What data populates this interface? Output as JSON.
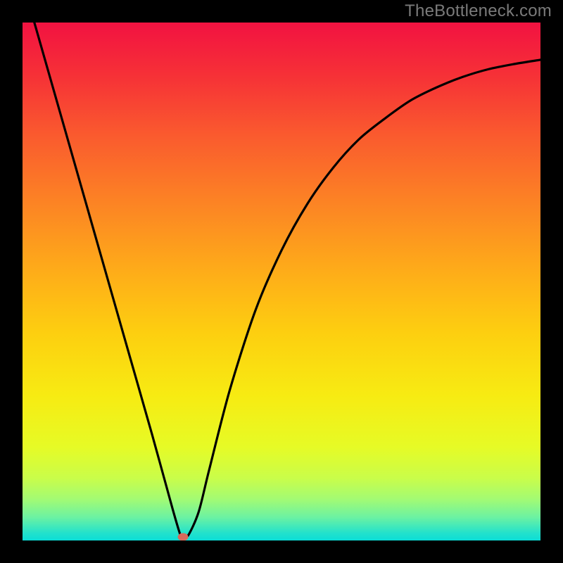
{
  "watermark_text": "TheBottleneck.com",
  "chart_data": {
    "type": "line",
    "title": "",
    "xlabel": "",
    "ylabel": "",
    "xlim": [
      0,
      1
    ],
    "ylim": [
      0,
      1
    ],
    "grid": false,
    "series": [
      {
        "name": "bottleneck-curve",
        "x": [
          0.0,
          0.05,
          0.1,
          0.15,
          0.2,
          0.25,
          0.29,
          0.305,
          0.31,
          0.32,
          0.34,
          0.36,
          0.4,
          0.45,
          0.5,
          0.55,
          0.6,
          0.65,
          0.7,
          0.75,
          0.8,
          0.85,
          0.9,
          0.95,
          1.0
        ],
        "values": [
          1.08,
          0.905,
          0.73,
          0.555,
          0.38,
          0.205,
          0.06,
          0.01,
          0.007,
          0.01,
          0.055,
          0.135,
          0.29,
          0.445,
          0.56,
          0.65,
          0.72,
          0.775,
          0.815,
          0.85,
          0.875,
          0.895,
          0.91,
          0.92,
          0.928
        ]
      }
    ],
    "minimum_point": {
      "x": 0.31,
      "y": 0.007
    },
    "marker_color": "#d86a5c",
    "gradient": {
      "stops": [
        {
          "offset": 0.0,
          "color": "#f21241"
        },
        {
          "offset": 0.1,
          "color": "#f63037"
        },
        {
          "offset": 0.22,
          "color": "#fa5b2e"
        },
        {
          "offset": 0.35,
          "color": "#fc8424"
        },
        {
          "offset": 0.48,
          "color": "#feac19"
        },
        {
          "offset": 0.6,
          "color": "#fdcf10"
        },
        {
          "offset": 0.72,
          "color": "#f7eb12"
        },
        {
          "offset": 0.82,
          "color": "#e6fb26"
        },
        {
          "offset": 0.88,
          "color": "#c9fd4a"
        },
        {
          "offset": 0.92,
          "color": "#a3fb73"
        },
        {
          "offset": 0.955,
          "color": "#6cf2a2"
        },
        {
          "offset": 0.985,
          "color": "#24e2cb"
        },
        {
          "offset": 1.0,
          "color": "#0bddd6"
        }
      ]
    }
  }
}
